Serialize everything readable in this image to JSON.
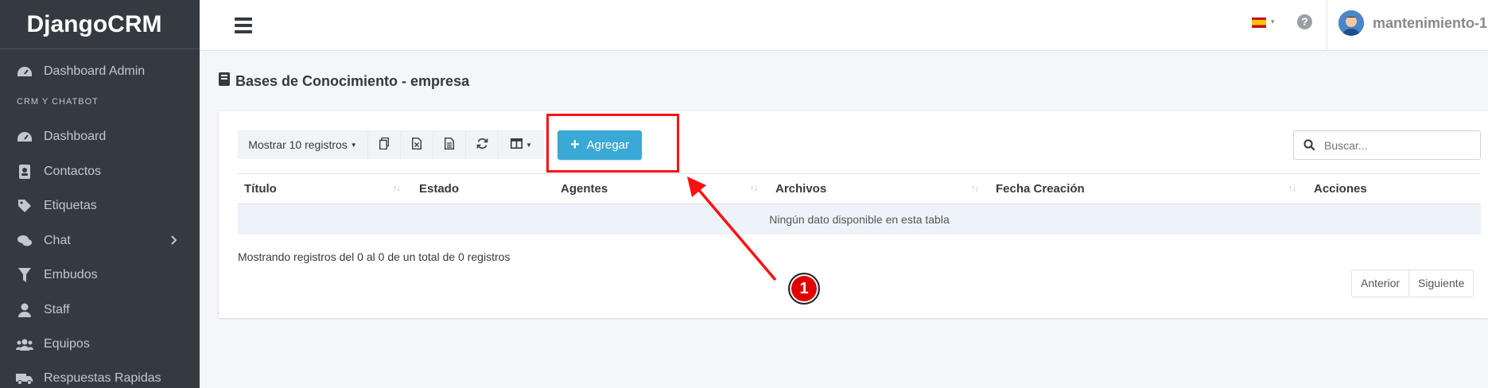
{
  "sidebar": {
    "brand": "DjangoCRM",
    "header": "CRM Y CHATBOT",
    "items": [
      {
        "label": "Dashboard Admin",
        "icon": "tachometer-icon"
      },
      {
        "label": "Dashboard",
        "icon": "tachometer-icon"
      },
      {
        "label": "Contactos",
        "icon": "address-book-icon"
      },
      {
        "label": "Etiquetas",
        "icon": "tag-icon"
      },
      {
        "label": "Chat",
        "icon": "comments-icon"
      },
      {
        "label": "Embudos",
        "icon": "filter-icon"
      },
      {
        "label": "Staff",
        "icon": "user-icon"
      },
      {
        "label": "Equipos",
        "icon": "users-icon"
      },
      {
        "label": "Respuestas Rapidas",
        "icon": "truck-icon"
      }
    ]
  },
  "topbar": {
    "username": "mantenimiento-1"
  },
  "page": {
    "title": "Bases de Conocimiento - empresa"
  },
  "toolbar": {
    "page_length": "Mostrar 10 registros",
    "add_label": "Agregar",
    "search_placeholder": "Buscar..."
  },
  "table": {
    "columns": [
      "Título",
      "Estado",
      "Agentes",
      "Archivos",
      "Fecha Creación",
      "Acciones"
    ],
    "empty_message": "Ningún dato disponible en esta tabla",
    "info": "Mostrando registros del 0 al 0 de un total de 0 registros",
    "prev": "Anterior",
    "next": "Siguiente"
  },
  "annotation": {
    "step": "1",
    "color": "#ff1010"
  }
}
